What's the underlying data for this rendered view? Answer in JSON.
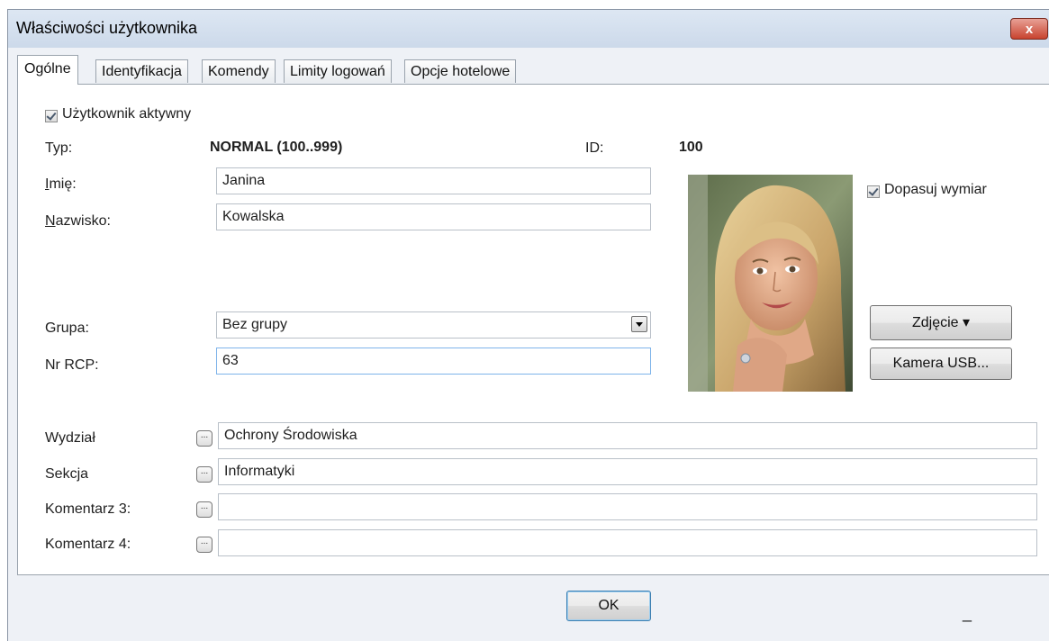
{
  "window": {
    "title": "Właściwości użytkownika",
    "close_label": "x"
  },
  "tabs": [
    {
      "label": "Ogólne",
      "active": true
    },
    {
      "label": "Identyfikacja",
      "active": false
    },
    {
      "label": "Komendy",
      "active": false
    },
    {
      "label": "Limity logowań",
      "active": false
    },
    {
      "label": "Opcje hotelowe",
      "active": false
    }
  ],
  "general": {
    "active_checkbox_label": "Użytkownik aktywny",
    "active_checked": true,
    "type_label": "Typ:",
    "type_value": "NORMAL (100..999)",
    "id_label": "ID:",
    "id_value": "100",
    "first_name_label_u": "I",
    "first_name_label_rest": "mię:",
    "first_name_value": "Janina",
    "last_name_label_u": "N",
    "last_name_label_rest": "azwisko:",
    "last_name_value": "Kowalska",
    "group_label": "Grupa:",
    "group_value": "Bez grupy",
    "rcp_label": "Nr RCP:",
    "rcp_value": "63"
  },
  "photo": {
    "fit_checkbox_label": "Dopasuj wymiar",
    "fit_checked": true,
    "photo_button_label": "Zdjęcie ▾",
    "camera_button_label": "Kamera USB..."
  },
  "comments": [
    {
      "label": "Wydział",
      "value": "Ochrony Środowiska",
      "button": "..."
    },
    {
      "label": "Sekcja",
      "value": "Informatyki",
      "button": "..."
    },
    {
      "label": "Komentarz 3:",
      "value": "",
      "button": "..."
    },
    {
      "label": "Komentarz 4:",
      "value": "",
      "button": "..."
    }
  ],
  "footer": {
    "ok_label": "OK",
    "extra_label": "_"
  },
  "colors": {
    "window_bg": "#eef1f6",
    "close_red": "#c8432f",
    "focus_blue": "#7eb4ea"
  }
}
